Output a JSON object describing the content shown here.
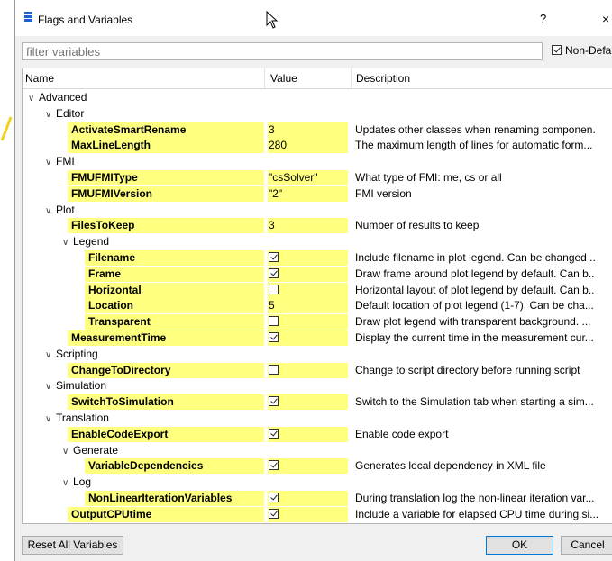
{
  "window": {
    "title": "Flags and Variables",
    "help_label": "?",
    "close_label": "×"
  },
  "filter": {
    "placeholder": "filter variables",
    "nondefault_label": "Non-Defaul",
    "nondefault_checked": true
  },
  "columns": {
    "name": "Name",
    "value": "Value",
    "description": "Description"
  },
  "groups": [
    {
      "label": "Advanced",
      "depth": 0,
      "row": 0
    },
    {
      "label": "Editor",
      "depth": 1,
      "row": 1
    },
    {
      "label": "FMI",
      "depth": 1,
      "row": 4
    },
    {
      "label": "Plot",
      "depth": 1,
      "row": 7
    },
    {
      "label": "Legend",
      "depth": 2,
      "row": 9
    },
    {
      "label": "Scripting",
      "depth": 1,
      "row": 16
    },
    {
      "label": "Simulation",
      "depth": 1,
      "row": 18
    },
    {
      "label": "Translation",
      "depth": 1,
      "row": 20
    },
    {
      "label": "Generate",
      "depth": 2,
      "row": 22
    },
    {
      "label": "Log",
      "depth": 2,
      "row": 24
    }
  ],
  "variables": [
    {
      "name": "ActivateSmartRename",
      "value": "3",
      "description": "Updates other classes when renaming componen.",
      "depth": 2,
      "row": 2
    },
    {
      "name": "MaxLineLength",
      "value": "280",
      "description": "The maximum length of lines for automatic form...",
      "depth": 2,
      "row": 3
    },
    {
      "name": "FMUFMIType",
      "value": "\"csSolver\"",
      "description": "What type of FMI: me, cs or all",
      "depth": 2,
      "row": 5
    },
    {
      "name": "FMUFMIVersion",
      "value": "\"2\"",
      "description": "FMI version",
      "depth": 2,
      "row": 6
    },
    {
      "name": "FilesToKeep",
      "value": "3",
      "description": "Number of results to keep",
      "depth": 2,
      "row": 8
    },
    {
      "name": "Filename",
      "checkbox": true,
      "checked": true,
      "description": "Include filename in plot legend. Can be changed ..",
      "depth": 3,
      "row": 10
    },
    {
      "name": "Frame",
      "checkbox": true,
      "checked": true,
      "description": "Draw frame around plot legend by default. Can b..",
      "depth": 3,
      "row": 11
    },
    {
      "name": "Horizontal",
      "checkbox": true,
      "checked": false,
      "description": "Horizontal layout of plot legend by default. Can b..",
      "depth": 3,
      "row": 12
    },
    {
      "name": "Location",
      "value": "5",
      "description": "Default location of plot legend (1-7). Can be cha...",
      "depth": 3,
      "row": 13
    },
    {
      "name": "Transparent",
      "checkbox": true,
      "checked": false,
      "description": "Draw plot legend with transparent background. ...",
      "depth": 3,
      "row": 14
    },
    {
      "name": "MeasurementTime",
      "checkbox": true,
      "checked": true,
      "description": "Display the current time in the measurement cur...",
      "depth": 2,
      "row": 15
    },
    {
      "name": "ChangeToDirectory",
      "checkbox": true,
      "checked": false,
      "description": "Change to script directory before running script",
      "depth": 2,
      "row": 17
    },
    {
      "name": "SwitchToSimulation",
      "checkbox": true,
      "checked": true,
      "description": "Switch to the Simulation tab when starting a sim...",
      "depth": 2,
      "row": 19
    },
    {
      "name": "EnableCodeExport",
      "checkbox": true,
      "checked": true,
      "description": "Enable code export",
      "depth": 2,
      "row": 21
    },
    {
      "name": "VariableDependencies",
      "checkbox": true,
      "checked": true,
      "description": "Generates local dependency in XML file",
      "depth": 3,
      "row": 23
    },
    {
      "name": "NonLinearIterationVariables",
      "checkbox": true,
      "checked": true,
      "description": "During translation log the non-linear iteration var...",
      "depth": 3,
      "row": 25
    },
    {
      "name": "OutputCPUtime",
      "checkbox": true,
      "checked": true,
      "description": "Include a variable for elapsed CPU time during si...",
      "depth": 2,
      "row": 26
    }
  ],
  "buttons": {
    "reset": "Reset All Variables",
    "ok": "OK",
    "cancel": "Cancel"
  },
  "colors": {
    "highlight": "#ffff80",
    "accent_icon": "#1f5fd1",
    "ok_border": "#0078d7"
  }
}
